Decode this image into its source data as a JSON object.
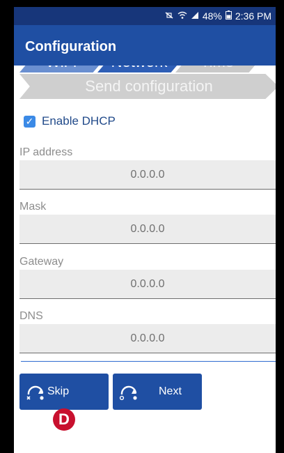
{
  "status_bar": {
    "icons": [
      "mute-vibrate-icon",
      "wifi-icon",
      "signal-icon",
      "battery-icon"
    ],
    "battery": "48%",
    "time": "2:36 PM"
  },
  "app_bar": {
    "title": "Configuration"
  },
  "stepper": {
    "steps": [
      {
        "label": "WiFi",
        "state": "done"
      },
      {
        "label": "Network",
        "state": "active"
      },
      {
        "label": "Time",
        "state": "pending"
      }
    ],
    "send_label": "Send configuration"
  },
  "form": {
    "dhcp": {
      "label": "Enable DHCP",
      "checked": true
    },
    "fields": [
      {
        "label": "IP address",
        "value": "0.0.0.0"
      },
      {
        "label": "Mask",
        "value": "0.0.0.0"
      },
      {
        "label": "Gateway",
        "value": "0.0.0.0"
      },
      {
        "label": "DNS",
        "value": "0.0.0.0"
      }
    ]
  },
  "buttons": {
    "skip_label": "Skip",
    "next_label": "Next"
  },
  "annotation": {
    "marker": "D"
  },
  "colors": {
    "app_bar": "#1f4fa3",
    "status_bar": "#17367a",
    "checkbox": "#3b8ae6",
    "marker": "#c8102e"
  }
}
